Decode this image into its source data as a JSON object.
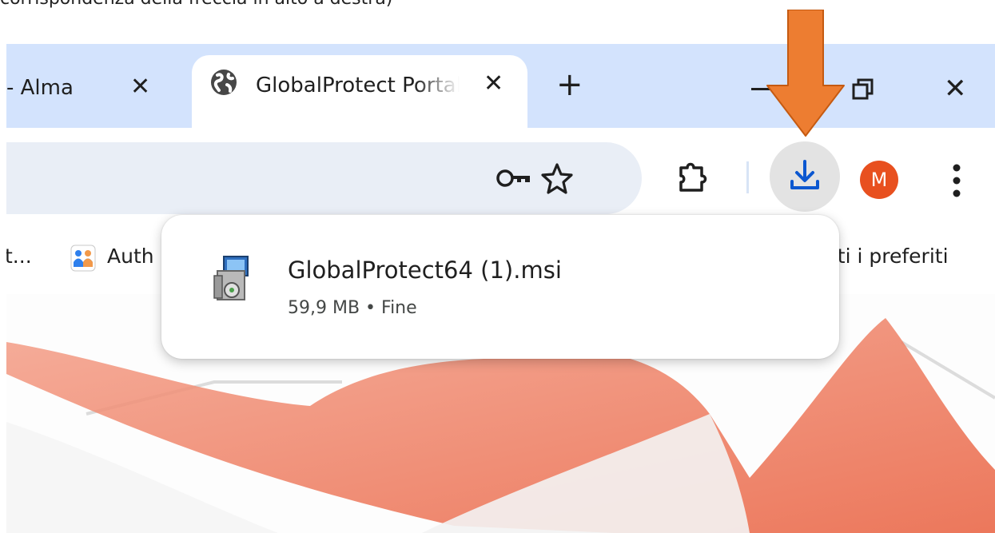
{
  "caption": "corrispondenza della freccia in alto a destra)",
  "tabs": {
    "previous": {
      "label": "- Alma",
      "close": "✕"
    },
    "active": {
      "title": "GlobalProtect Portal",
      "close": "✕",
      "icon": "globe-icon"
    },
    "new_tab": "+"
  },
  "window_controls": {
    "minimize": "minimize-icon",
    "restore": "restore-icon",
    "close": "✕"
  },
  "toolbar": {
    "icons": [
      "key-icon",
      "star-icon",
      "extensions-icon",
      "download-icon",
      "menu-icon"
    ],
    "avatar_letter": "M",
    "avatar_color": "#e8501f"
  },
  "bookmarks": {
    "left_truncated": "t...",
    "auth_label": "Auth",
    "all_bookmarks": "tti i preferiti"
  },
  "download_popup": {
    "file_name": "GlobalProtect64 (1).msi",
    "status": "59,9 MB • Fine",
    "icon": "msi-installer-icon"
  },
  "annotation": {
    "color": "#ed7d31",
    "icon": "down-arrow"
  },
  "colors": {
    "tabstrip": "#d3e3fd",
    "omnibox": "#e9eef6",
    "download_accent": "#0b57d0"
  }
}
